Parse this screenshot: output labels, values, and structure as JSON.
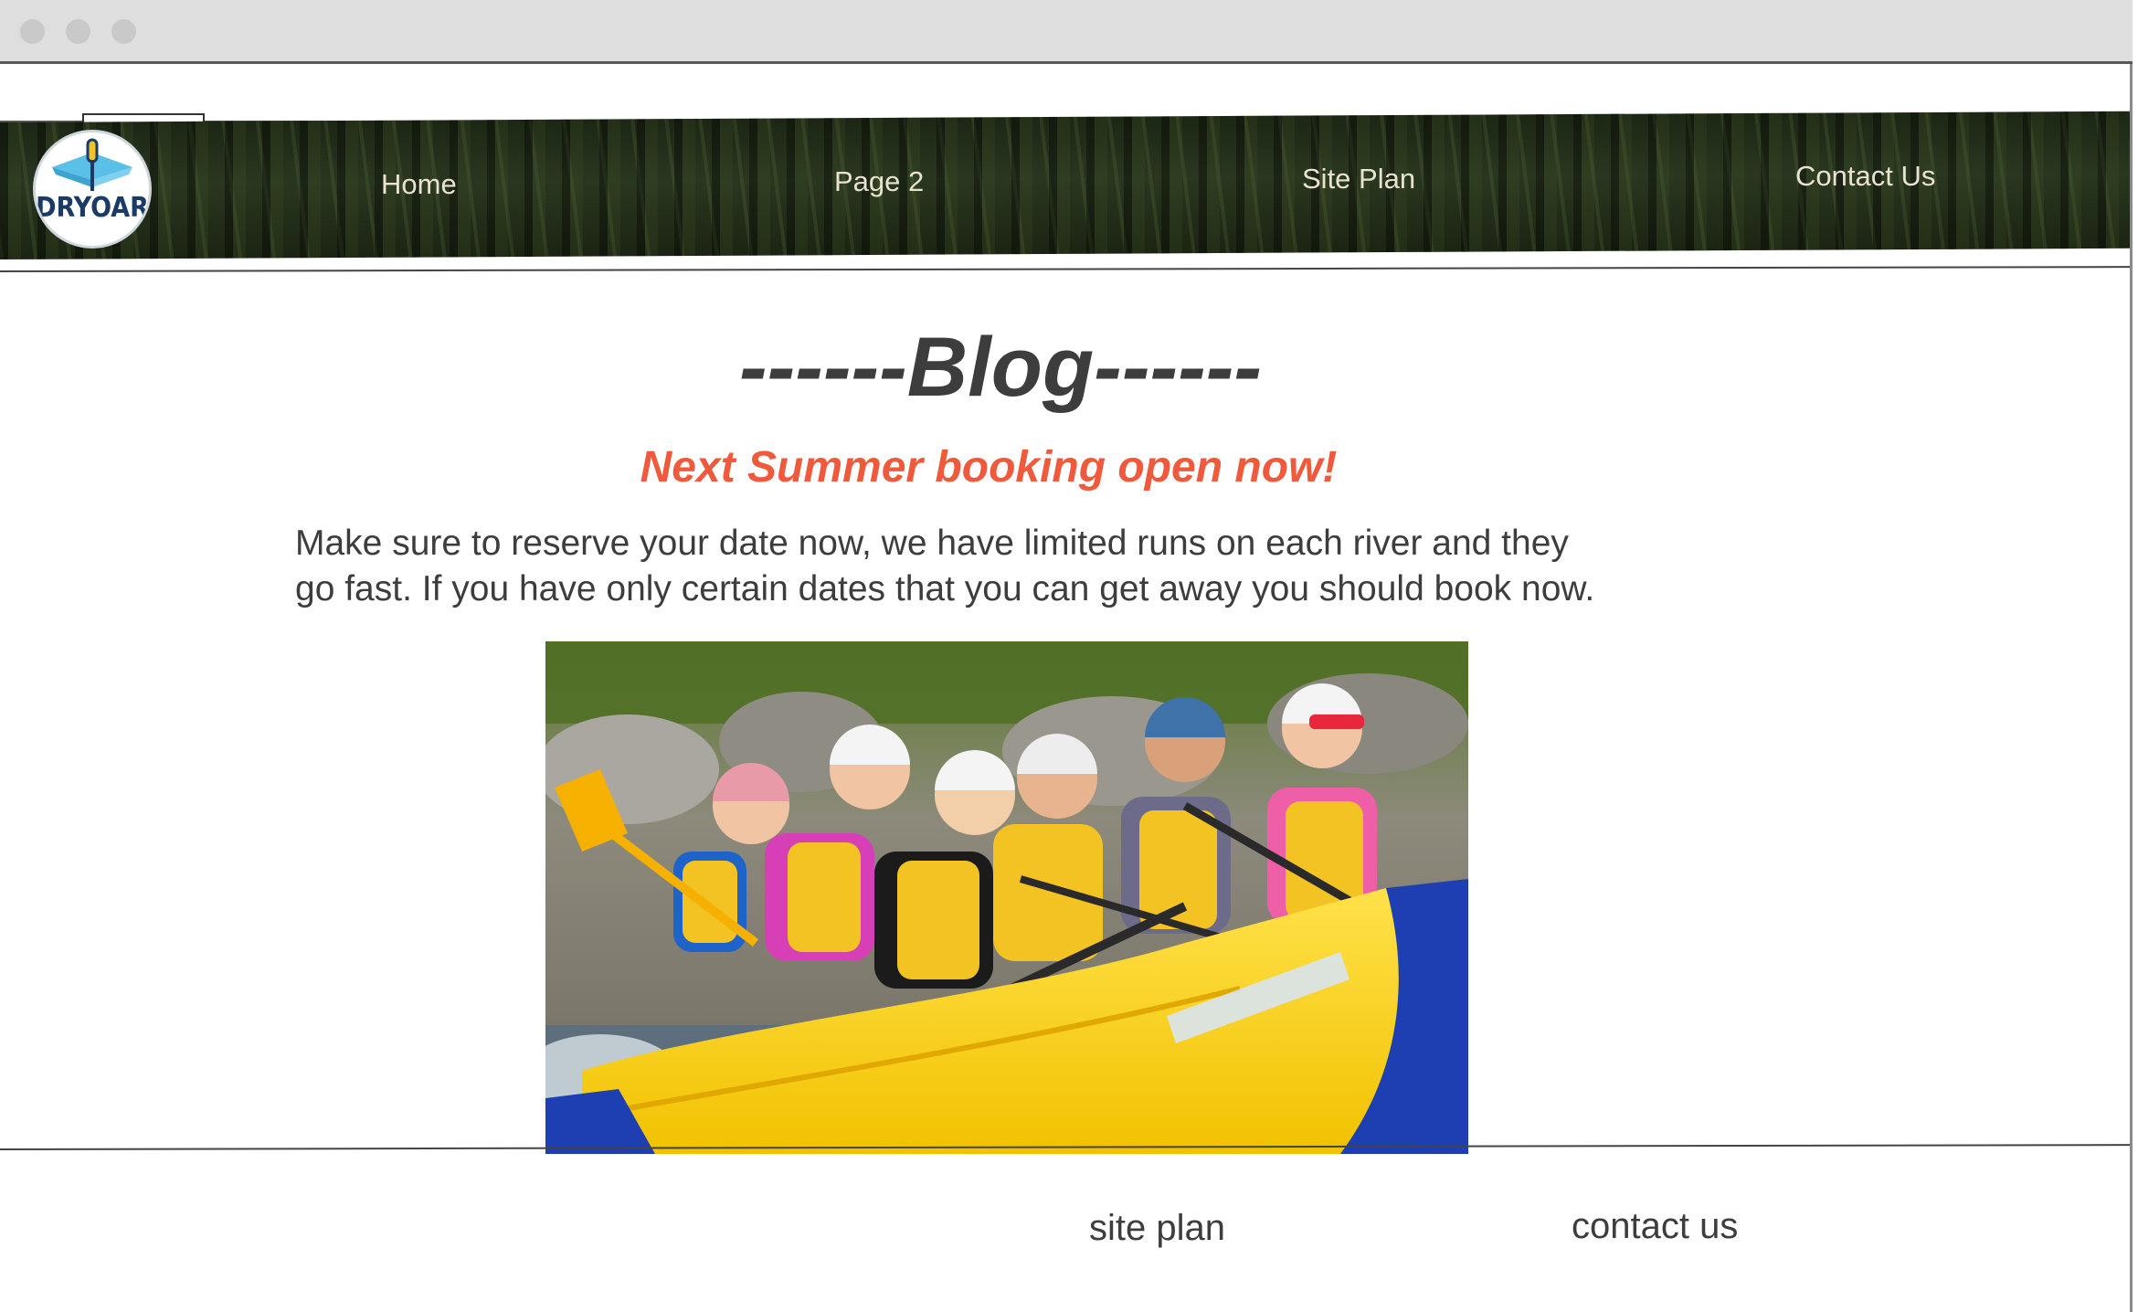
{
  "window": {
    "controls": [
      "close-dot",
      "minimize-dot",
      "maximize-dot"
    ]
  },
  "header": {
    "logo_text": "DRYOAR",
    "nav": {
      "home": "Home",
      "page2": "Page 2",
      "site_plan": "Site Plan",
      "contact_us": "Contact Us"
    }
  },
  "main": {
    "title": "------Blog------",
    "subtitle": "Next Summer booking open now!",
    "body_lines": [
      "Make sure to reserve your date now, we have limited runs on each river and they",
      "go fast. If you have only certain dates that you can get away you should book now."
    ],
    "photo_icon": "rafting-photo"
  },
  "footer": {
    "site_plan": "site plan",
    "contact_us": "contact us"
  },
  "colors": {
    "accent": "#f05a3c",
    "text": "#3d3d3d",
    "nav_text": "#e9e2cf"
  }
}
